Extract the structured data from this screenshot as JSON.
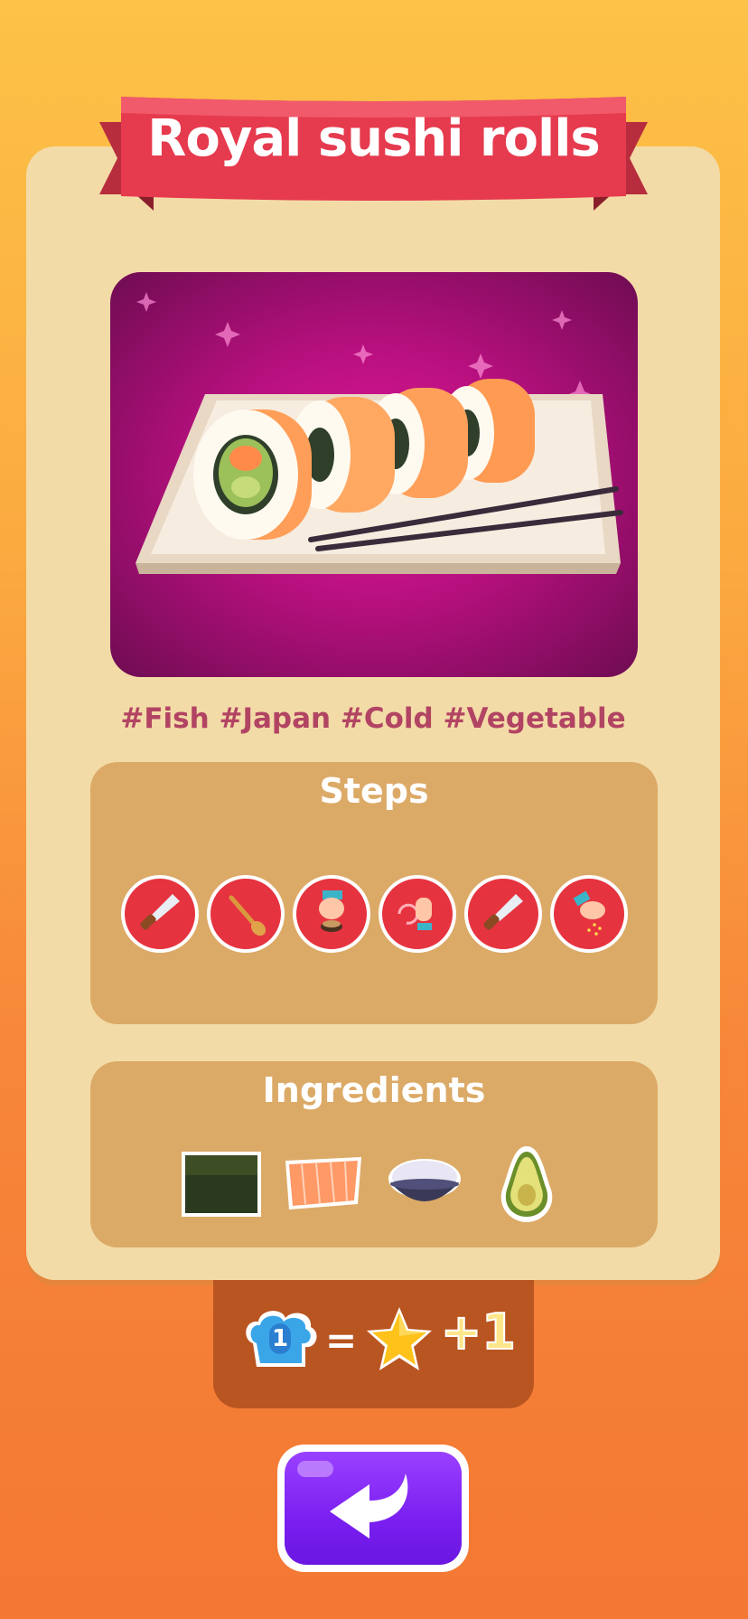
{
  "recipe": {
    "title": "Royal sushi rolls",
    "tags": "#Fish #Japan #Cold #Vegetable"
  },
  "steps": {
    "title": "Steps",
    "items": [
      "knife-icon",
      "spoon-icon",
      "hand-press-icon",
      "hand-roll-icon",
      "knife-icon",
      "hand-sprinkle-icon"
    ]
  },
  "ingredients": {
    "title": "Ingredients",
    "items": [
      "nori-icon",
      "salmon-icon",
      "rice-bowl-icon",
      "avocado-icon"
    ]
  },
  "reward": {
    "count": "1",
    "equals": "=",
    "bonus": "+1"
  },
  "colors": {
    "ribbon": "#e63a4e",
    "card": "#f3dba7",
    "panel": "#dcaa67",
    "tag_text": "#b24463",
    "button": "#7a1ff0"
  }
}
